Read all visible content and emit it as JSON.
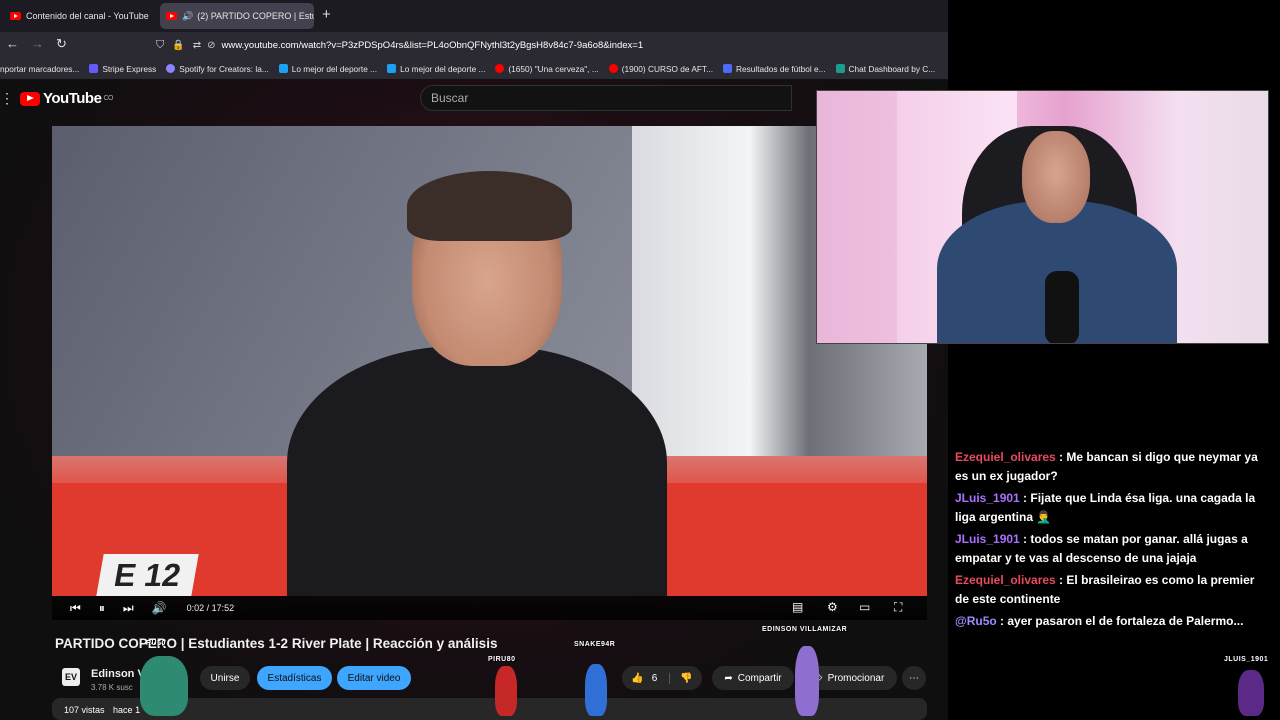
{
  "browser": {
    "tabs": [
      {
        "title": "Contenido del canal - YouTube",
        "active": false
      },
      {
        "title": "(2) PARTIDO COPERO | Estu",
        "active": true
      }
    ],
    "new_tab_icon": "plus-icon",
    "url": "www.youtube.com/watch?v=P3zPDSpO4rs&list=PL4oObnQFNythl3t2yBgsH8v84c7-9a6o8&index=1",
    "bookmarks": [
      "nportar marcadores...",
      "Stripe Express",
      "Spotify for Creators: la...",
      "Lo mejor del deporte ...",
      "Lo mejor del deporte ...",
      "(1650) \"Una cerveza\", ...",
      "(1900) CURSO de AFT...",
      "Resultados de fútbol e...",
      "Chat Dashboard by C..."
    ]
  },
  "youtube": {
    "logo_text": "YouTube",
    "region": "CO",
    "search_placeholder": "Buscar",
    "player": {
      "time": "0:02 / 17:52",
      "sign_text": "E 12"
    },
    "video_title": "PARTIDO COPERO | Estudiantes 1-2 River Plate | Reacción y análisis",
    "channel": {
      "logo_text": "EV",
      "name": "Edinson V",
      "subscribers": "3.78 K susc"
    },
    "buttons": {
      "join": "Unirse",
      "stats": "Estadísticas",
      "edit": "Editar video",
      "likes": "6",
      "share": "Compartir",
      "promote": "Promocionar"
    },
    "description": {
      "views": "107 vistas",
      "time": "hace 1"
    }
  },
  "overlay_sprites": [
    {
      "name": "PIRU80"
    },
    {
      "name": "SNAKE94R"
    },
    {
      "name": "EDINSON VILLAMIZAR"
    },
    {
      "name": "JLUIS_1901"
    },
    {
      "name": "RU50"
    }
  ],
  "chat": [
    {
      "user": "Ezequiel_olivares",
      "color": "#e84a5f",
      "text": "Me bancan si digo que neymar ya es un ex jugador?"
    },
    {
      "user": "JLuis_1901",
      "color": "#a970ff",
      "text": "Fijate que Linda ésa liga. una cagada la liga argentina 🤦‍♂️"
    },
    {
      "user": "JLuis_1901",
      "color": "#a970ff",
      "text": "todos se matan por ganar. allá jugas a empatar y te vas al descenso de una jajaja"
    },
    {
      "user": "Ezequiel_olivares",
      "color": "#e84a5f",
      "text": "El brasileirao es como la premier de este continente"
    },
    {
      "user": "@Ru5o",
      "color": "#9b8cff",
      "text": "ayer pasaron el de fortaleza de Palermo..."
    }
  ]
}
